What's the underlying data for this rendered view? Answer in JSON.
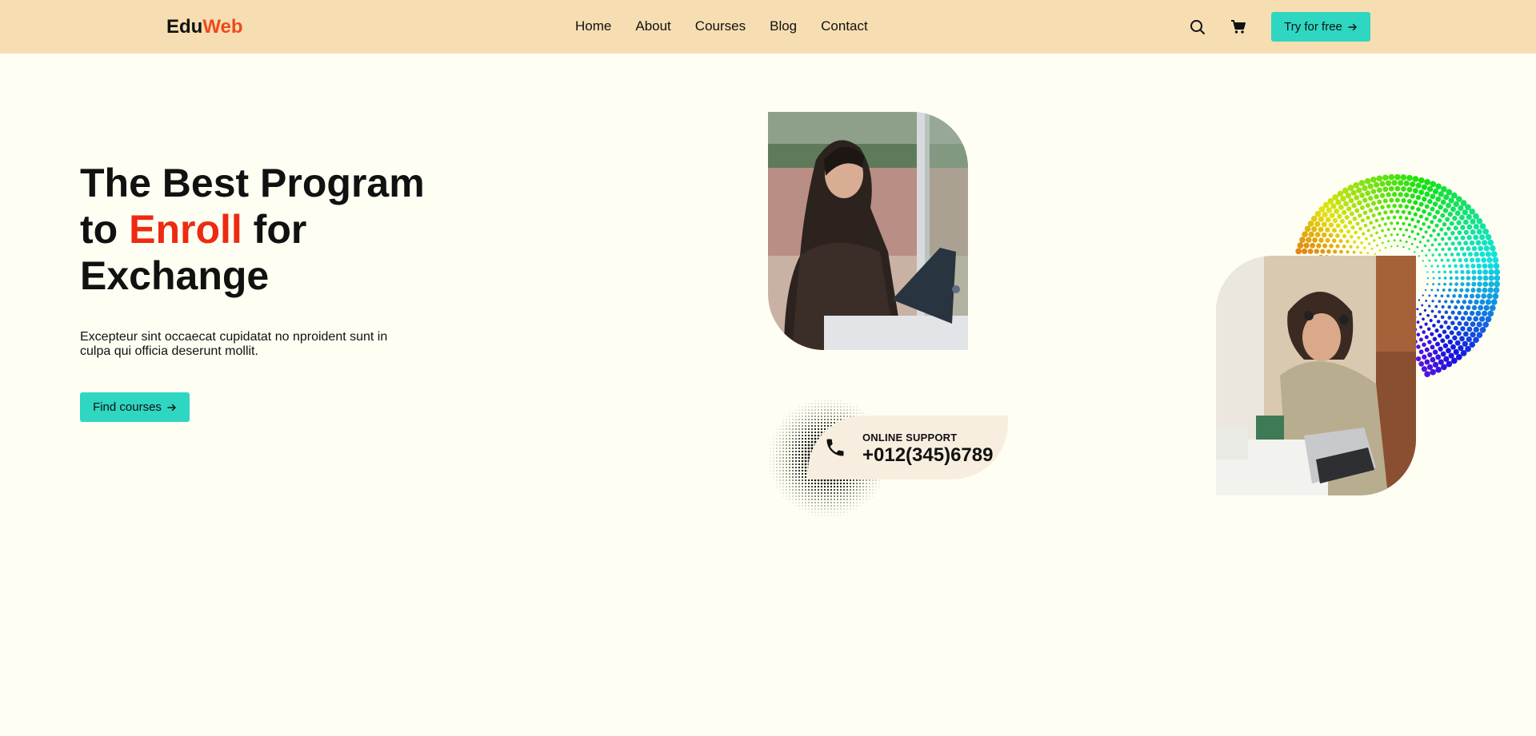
{
  "header": {
    "logo": {
      "part1": "Edu",
      "part2": "Web"
    },
    "nav": [
      "Home",
      "About",
      "Courses",
      "Blog",
      "Contact"
    ],
    "icons": [
      "search-icon",
      "cart-icon"
    ],
    "cta_label": "Try for free"
  },
  "hero": {
    "title_line1": "The Best Program",
    "title_prefix": "to ",
    "title_accent": "Enroll",
    "title_suffix": " for",
    "title_line3": "Exchange",
    "description": "Excepteur sint occaecat cupidatat no nproident sunt in culpa qui officia deserunt mollit.",
    "button_label": "Find courses"
  },
  "support": {
    "label": "ONLINE SUPPORT",
    "phone": "+012(345)6789",
    "icon": "phone-icon"
  },
  "colors": {
    "header_bg": "#f6deb2",
    "page_bg": "#fefff2",
    "accent_teal": "#2fd6c2",
    "accent_red": "#ee2a12",
    "logo_orange": "#ee4a1c",
    "support_bg": "#f8eedf"
  }
}
